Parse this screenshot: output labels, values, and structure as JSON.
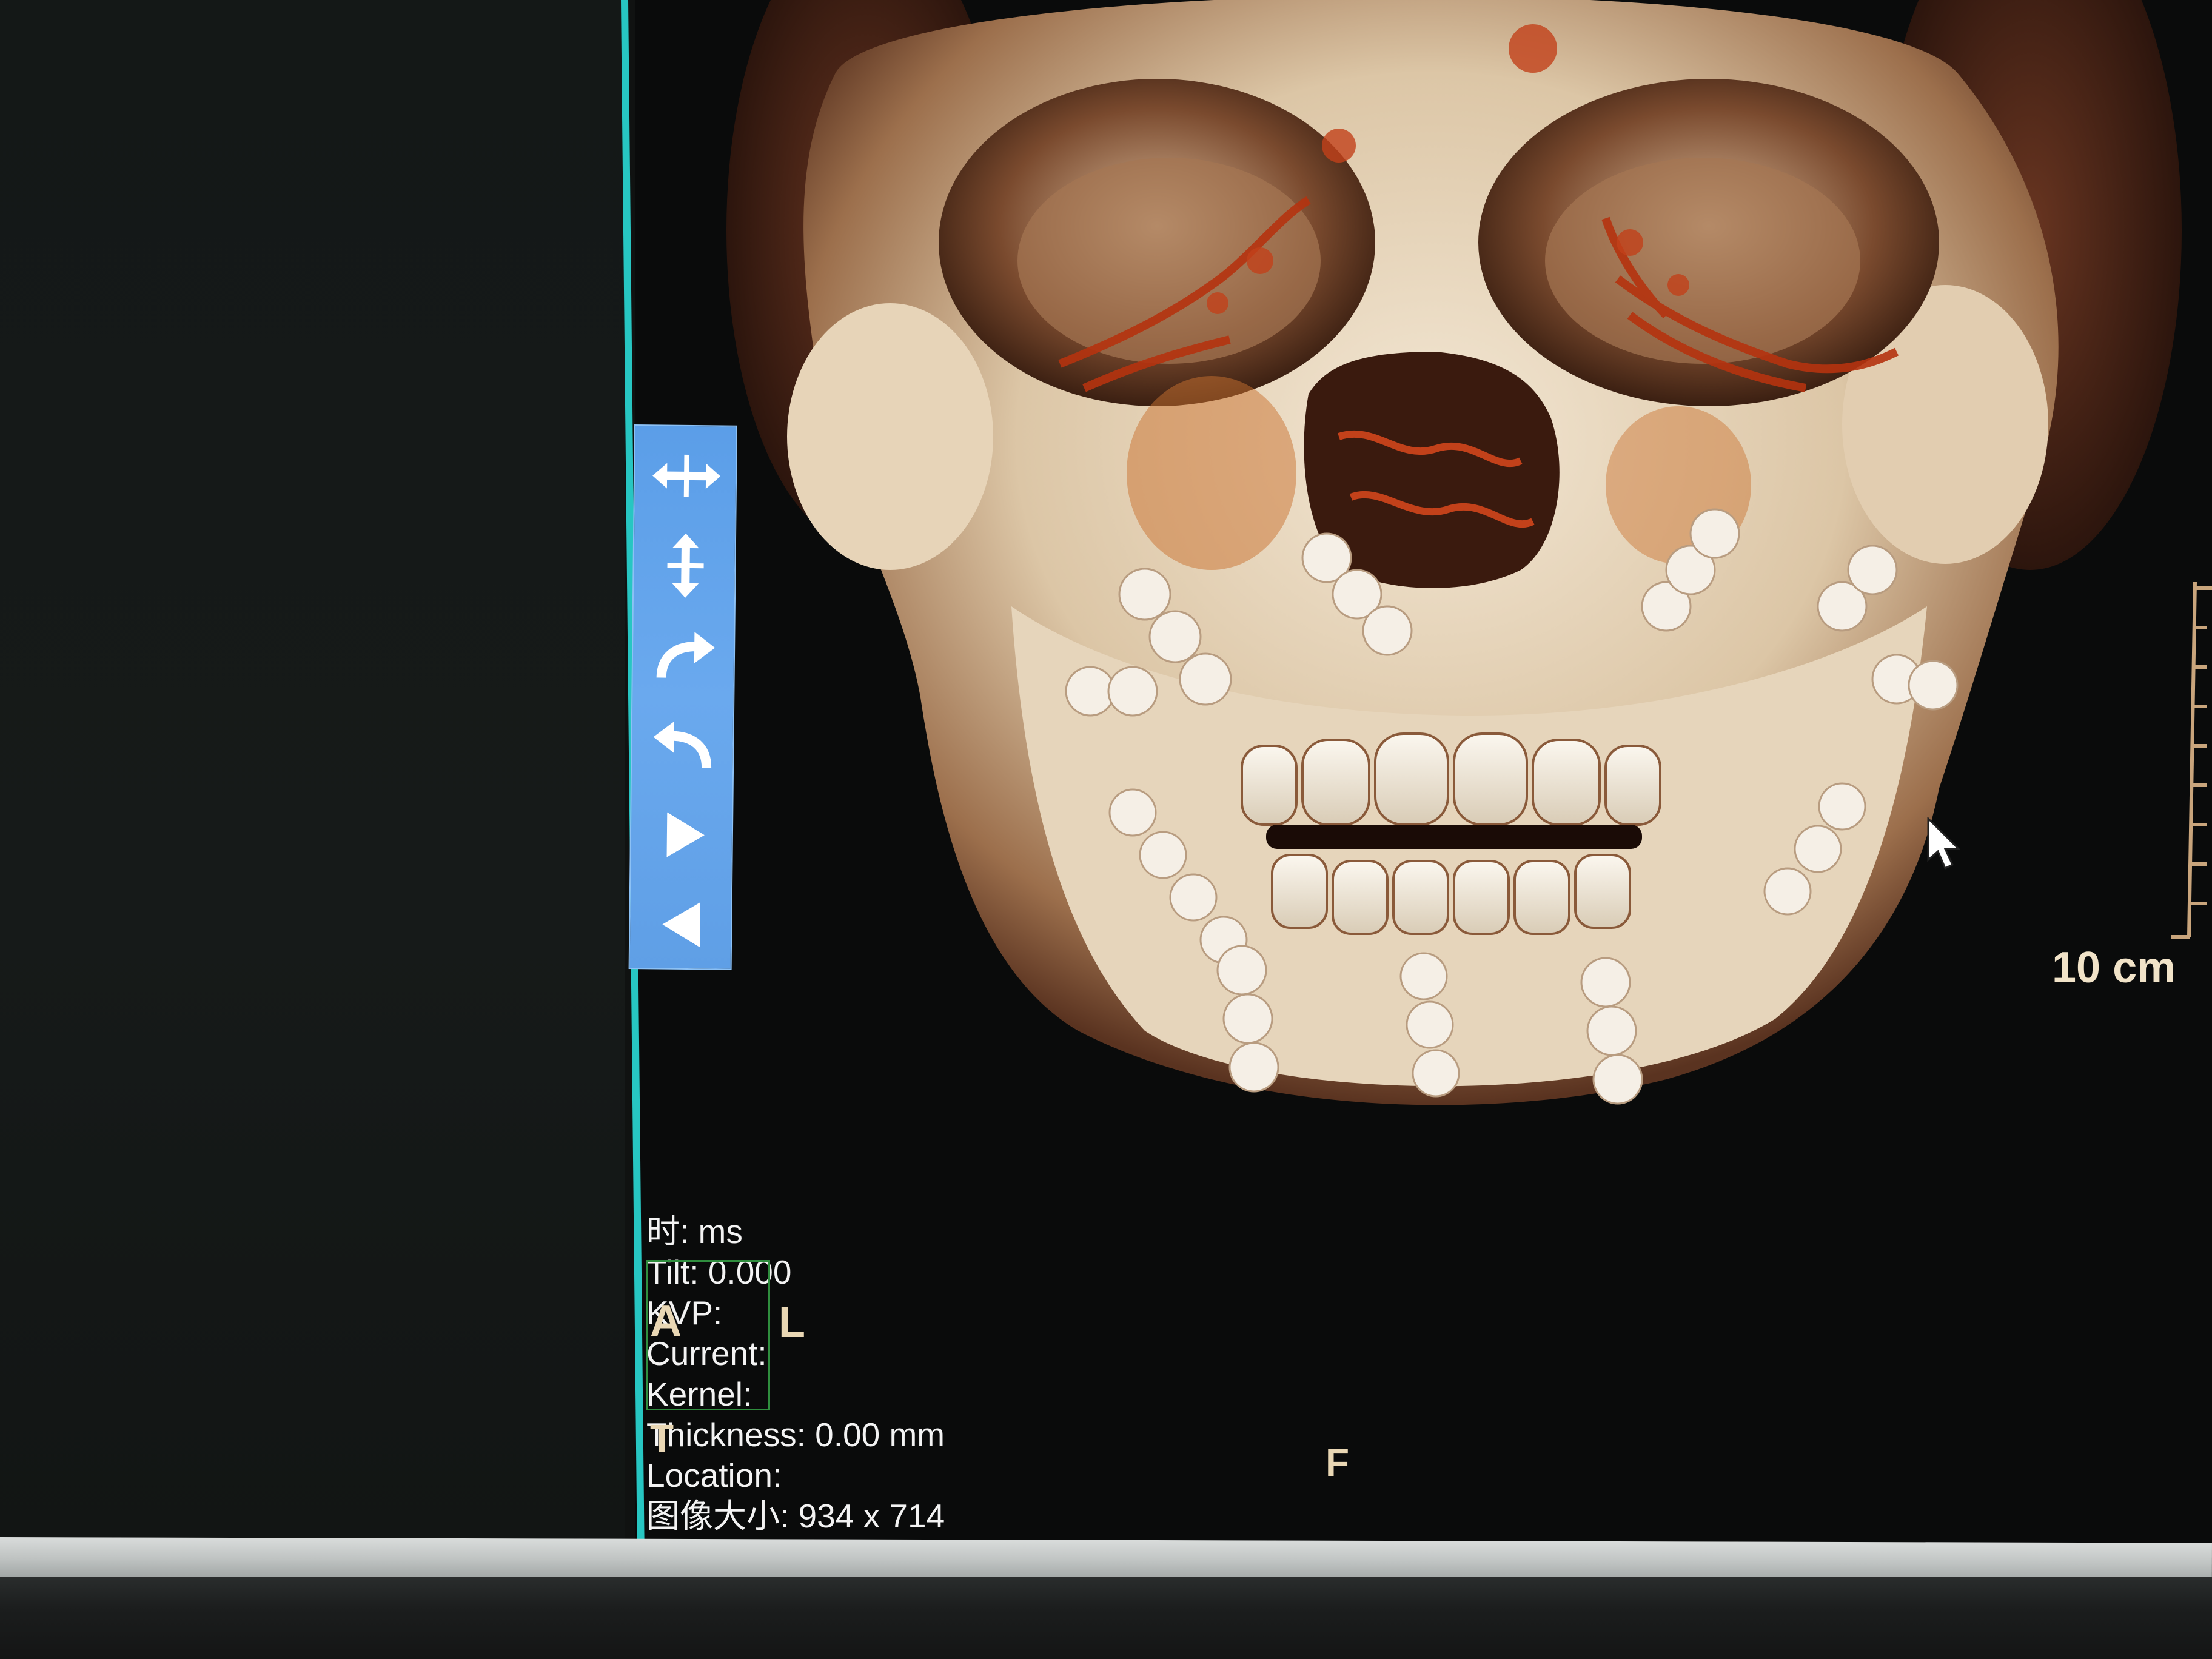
{
  "toolbar": {
    "buttons": [
      {
        "icon": "pan-horizontal-icon"
      },
      {
        "icon": "pan-vertical-icon"
      },
      {
        "icon": "rotate-right-icon"
      },
      {
        "icon": "rotate-left-icon"
      },
      {
        "icon": "play-forward-icon"
      },
      {
        "icon": "play-backward-icon"
      }
    ]
  },
  "viewer": {
    "scale_label": "10 cm",
    "orientation": {
      "left_top": "A",
      "left_side": "L",
      "bottom": "F",
      "left_bottom": "T"
    },
    "info": {
      "time": "时:  ms",
      "tilt": "Tilt: 0.000",
      "kvp": "KVP:",
      "current": "Current:",
      "kernel": "Kernel:",
      "thickness": "Thickness: 0.00 mm",
      "location": "Location:",
      "image_size": "图像大小: 934 x 714"
    }
  },
  "colors": {
    "toolbar_bg": "#6aa9ee",
    "divider": "#27c6c2",
    "bone": "#e8d9c3",
    "vessel": "#b5330f",
    "label": "#f1e3c8"
  }
}
